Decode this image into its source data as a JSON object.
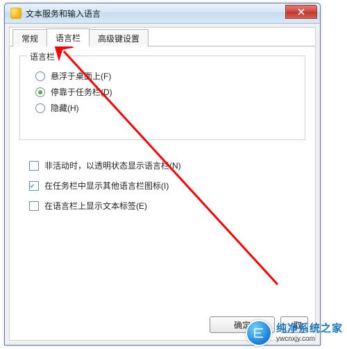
{
  "window": {
    "title": "文本服务和输入语言"
  },
  "tabs": [
    {
      "label": "常规"
    },
    {
      "label": "语言栏"
    },
    {
      "label": "高级键设置"
    }
  ],
  "active_tab_index": 1,
  "group": {
    "legend": "语言栏",
    "radios": [
      {
        "label": "悬浮于桌面上(F)",
        "checked": false
      },
      {
        "label": "停靠于任务栏(D)",
        "checked": true
      },
      {
        "label": "隐藏(H)",
        "checked": false
      }
    ]
  },
  "checks": [
    {
      "label": "非活动时，以透明状态显示语言栏(N)",
      "checked": false
    },
    {
      "label": "在任务栏中显示其他语言栏图标(I)",
      "checked": true
    },
    {
      "label": "在语言栏上显示文本标签(E)",
      "checked": false
    }
  ],
  "buttons": {
    "ok": "确定",
    "cancel_partial": "取"
  },
  "watermark": {
    "name": "纯净系统之家",
    "url": "ywcnxjy.com"
  }
}
